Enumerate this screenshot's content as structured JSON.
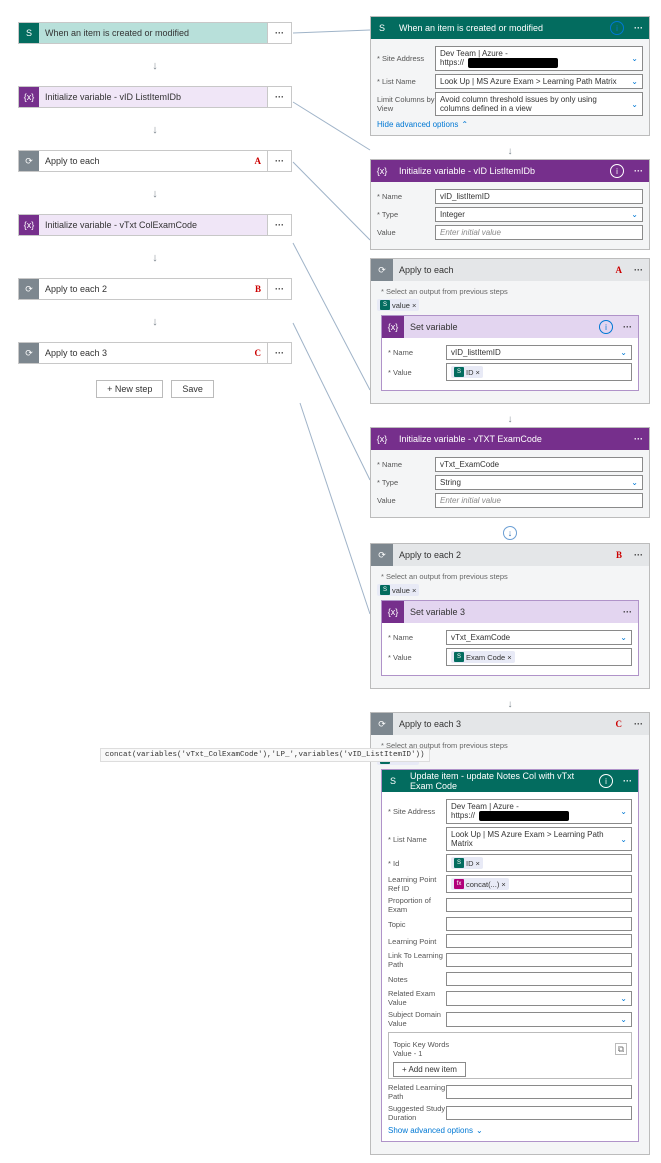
{
  "left": {
    "s1": {
      "title": "When an item is created or modified"
    },
    "s2": {
      "title": "Initialize variable - vID ListItemIDb"
    },
    "s3": {
      "title": "Apply to each",
      "ann": "A"
    },
    "s4": {
      "title": "Initialize variable - vTxt ColExamCode"
    },
    "s5": {
      "title": "Apply to each 2",
      "ann": "B"
    },
    "s6": {
      "title": "Apply to each 3",
      "ann": "C"
    },
    "newstep": "+ New step",
    "save": "Save"
  },
  "right": {
    "trigger": {
      "title": "When an item is created or modified",
      "siteLabel": "* Site Address",
      "siteLine1": "Dev Team | Azure -",
      "siteLine2": "https://",
      "listLabel": "* List Name",
      "listName": "Look Up | MS Azure Exam > Learning Path Matrix",
      "limitLabel": "Limit Columns by View",
      "limitVal": "Avoid column threshold issues by only using columns defined in a view",
      "hide": "Hide advanced options"
    },
    "initVar1": {
      "title": "Initialize variable - vID ListItemIDb",
      "nameLab": "* Name",
      "nameVal": "vID_listItemID",
      "typeLab": "* Type",
      "typeVal": "Integer",
      "valLab": "Value",
      "valPh": "Enter initial value"
    },
    "apply1": {
      "title": "Apply to each",
      "ann": "A",
      "note": "* Select an output from previous steps",
      "token": "value",
      "setTitle": "Set variable",
      "nameLab": "* Name",
      "nameVal": "vID_listItemID",
      "valLab": "* Value",
      "valToken": "ID"
    },
    "initVar2": {
      "title": "Initialize variable - vTXT ExamCode",
      "nameLab": "* Name",
      "nameVal": "vTxt_ExamCode",
      "typeLab": "* Type",
      "typeVal": "String",
      "valLab": "Value",
      "valPh": "Enter initial value"
    },
    "apply2": {
      "title": "Apply to each 2",
      "ann": "B",
      "note": "* Select an output from previous steps",
      "token": "value",
      "setTitle": "Set variable 3",
      "nameLab": "* Name",
      "nameVal": "vTxt_ExamCode",
      "valLab": "* Value",
      "valToken": "Exam Code"
    },
    "apply3": {
      "title": "Apply to each 3",
      "ann": "C",
      "note": "* Select an output from previous steps",
      "token": "value",
      "upd": {
        "title": "Update item - update Notes Col with vTxt Exam Code",
        "siteLabel": "* Site Address",
        "siteLine1": "Dev Team | Azure -",
        "siteLine2": "https://",
        "listLabel": "* List Name",
        "listVal": "Look Up | MS Azure Exam > Learning Path Matrix",
        "idLabel": "* Id",
        "idToken": "ID",
        "lpRefLabel": "Learning Point Ref ID",
        "lpRefToken": "concat(...)",
        "f_prop": "Proportion of Exam",
        "f_topic": "Topic",
        "f_lp": "Learning Point",
        "f_link": "Link To Learning Path",
        "f_notes": "Notes",
        "f_rev": "Related Exam Value",
        "f_sdv": "Subject Domain Value",
        "f_tkw": "Topic Key Words Value - 1",
        "addBtn": "+  Add new item",
        "f_rlp": "Related Learning Path",
        "f_ssd": "Suggested Study Duration",
        "show": "Show advanced options"
      }
    }
  },
  "code": "concat(variables('vTxt_ColExamCode'),'LP_',variables('vID_ListItemID'))"
}
